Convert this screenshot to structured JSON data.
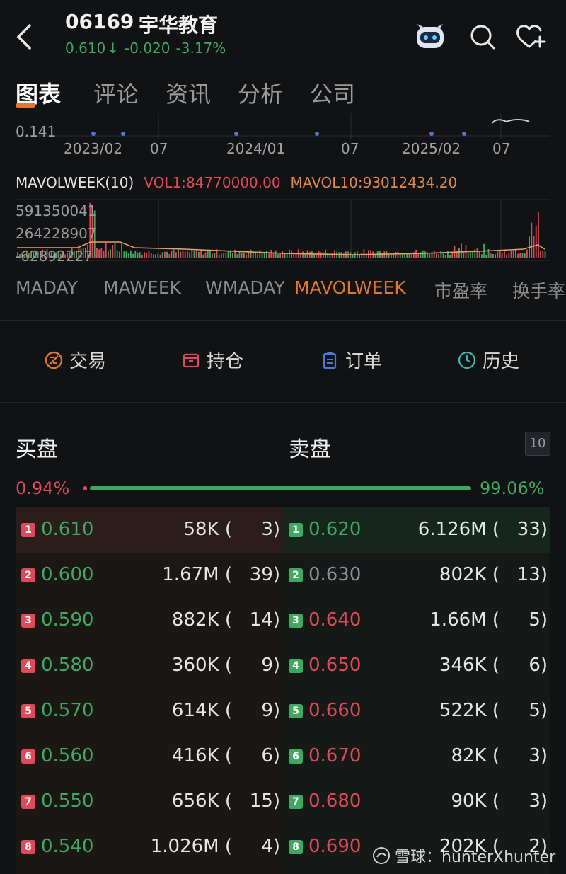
{
  "header": {
    "code": "06169",
    "name": "宇华教育",
    "price": "0.610",
    "arrow": "↓",
    "change": "-0.020",
    "change_pct": "-3.17%"
  },
  "tabs": [
    "图表",
    "评论",
    "资讯",
    "分析",
    "公司"
  ],
  "main_chart": {
    "price_label": "0.141",
    "x_ticks": [
      "2023/02",
      "07",
      "2024/01",
      "07",
      "2025/02",
      "07"
    ]
  },
  "indicator": {
    "name": "MAVOLWEEK(10)",
    "vol1": "VOL1:84770000.00",
    "mavol10": "MAVOL10:93012434.20",
    "y_labels": [
      "591350041",
      "264228907",
      "-62892227"
    ]
  },
  "indicator_tabs": [
    "MADAY",
    "MAWEEK",
    "WMADAY",
    "MAVOLWEEK",
    "市盈率",
    "换手率"
  ],
  "actions": [
    "交易",
    "持仓",
    "订单",
    "历史"
  ],
  "orderbook": {
    "bid_title": "买盘",
    "ask_title": "卖盘",
    "depth": "10",
    "bid_ratio": "0.94%",
    "ask_ratio": "99.06%",
    "bids": [
      {
        "level": "1",
        "price": "0.610",
        "volume": "58K (",
        "count": "3)"
      },
      {
        "level": "2",
        "price": "0.600",
        "volume": "1.67M (",
        "count": "39)"
      },
      {
        "level": "3",
        "price": "0.590",
        "volume": "882K (",
        "count": "14)"
      },
      {
        "level": "4",
        "price": "0.580",
        "volume": "360K (",
        "count": "9)"
      },
      {
        "level": "5",
        "price": "0.570",
        "volume": "614K (",
        "count": "9)"
      },
      {
        "level": "6",
        "price": "0.560",
        "volume": "416K (",
        "count": "6)"
      },
      {
        "level": "7",
        "price": "0.550",
        "volume": "656K (",
        "count": "15)"
      },
      {
        "level": "8",
        "price": "0.540",
        "volume": "1.026M (",
        "count": "4)"
      }
    ],
    "asks": [
      {
        "level": "1",
        "price": "0.620",
        "volume": "6.126M (",
        "count": "33)",
        "color": "#3fa961"
      },
      {
        "level": "2",
        "price": "0.630",
        "volume": "802K (",
        "count": "13)",
        "color": "#8a8f99"
      },
      {
        "level": "3",
        "price": "0.640",
        "volume": "1.66M (",
        "count": "5)",
        "color": "#e0495a"
      },
      {
        "level": "4",
        "price": "0.650",
        "volume": "346K (",
        "count": "6)",
        "color": "#e0495a"
      },
      {
        "level": "5",
        "price": "0.660",
        "volume": "522K (",
        "count": "5)",
        "color": "#e0495a"
      },
      {
        "level": "6",
        "price": "0.670",
        "volume": "82K (",
        "count": "3)",
        "color": "#e0495a"
      },
      {
        "level": "7",
        "price": "0.680",
        "volume": "90K (",
        "count": "3)",
        "color": "#e0495a"
      },
      {
        "level": "8",
        "price": "0.690",
        "volume": "202K (",
        "count": "2)",
        "color": "#e0495a"
      }
    ]
  },
  "watermark": "雪球：hunterXhunter",
  "colors": {
    "up": "#e0495a",
    "down": "#3fa961",
    "accent": "#e0772e",
    "vol1": "#e0495a",
    "mavol": "#e08a4a"
  }
}
